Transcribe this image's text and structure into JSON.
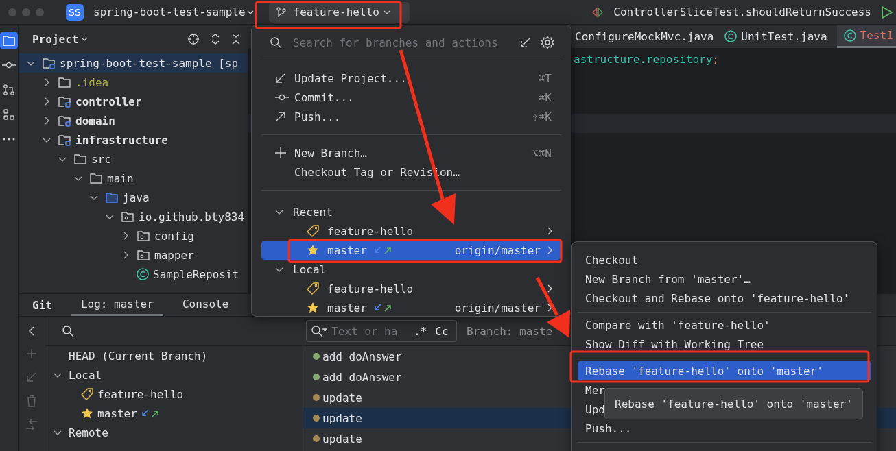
{
  "window": {
    "project_badge": "SS",
    "project": "spring-boot-test-sample",
    "branch": "feature-hello",
    "run_config": "ControllerSliceTest.shouldReturnSuccess"
  },
  "tool_strip": [
    {
      "selected": true
    },
    {
      "selected": false
    },
    {
      "selected": false
    },
    {
      "selected": false
    },
    {
      "selected": false
    }
  ],
  "project_panel": {
    "title": "Project",
    "tree": [
      {
        "label": "spring-boot-test-sample [sp",
        "kind": "module",
        "expanded": true,
        "selected": true,
        "ignored": false,
        "children": [
          {
            "label": ".idea",
            "kind": "folder",
            "expanded": false,
            "selected": false,
            "ignored": true
          },
          {
            "label": "controller",
            "kind": "module",
            "expanded": false,
            "selected": false,
            "ignored": false
          },
          {
            "label": "domain",
            "kind": "module",
            "expanded": false,
            "selected": false,
            "ignored": false
          },
          {
            "label": "infrastructure",
            "kind": "module",
            "expanded": true,
            "selected": false,
            "ignored": false,
            "children": [
              {
                "label": "src",
                "kind": "folder",
                "expanded": true,
                "selected": false,
                "ignored": false,
                "children": [
                  {
                    "label": "main",
                    "kind": "folder",
                    "expanded": true,
                    "selected": false,
                    "ignored": false,
                    "children": [
                      {
                        "label": "java",
                        "kind": "source",
                        "expanded": true,
                        "selected": false,
                        "ignored": false,
                        "children": [
                          {
                            "label": "io.github.bty834",
                            "kind": "package",
                            "expanded": true,
                            "selected": false,
                            "ignored": false,
                            "children": [
                              {
                                "label": "config",
                                "kind": "package",
                                "expanded": false,
                                "selected": false,
                                "ignored": false
                              },
                              {
                                "label": "mapper",
                                "kind": "package",
                                "expanded": false,
                                "selected": false,
                                "ignored": false
                              },
                              {
                                "label": "SampleReposit",
                                "kind": "class",
                                "selected": false,
                                "ignored": false
                              }
                            ]
                          }
                        ]
                      }
                    ]
                  }
                ]
              }
            ]
          }
        ]
      }
    ]
  },
  "editor": {
    "tabs": [
      {
        "label": "ConfigureMockMvc.java",
        "selected": false,
        "error": false,
        "icon": false
      },
      {
        "label": "UnitTest.java",
        "selected": false,
        "error": false,
        "icon": true
      },
      {
        "label": "Test1",
        "selected": true,
        "error": true,
        "icon": true
      }
    ],
    "code": [
      {
        "text": "astructure.repository",
        "kind": "identifier"
      },
      {
        "text": ";",
        "kind": "punct"
      }
    ]
  },
  "branch_popup": {
    "search": {
      "placeholder": "Search for branches and actions"
    },
    "action_groups": [
      [
        {
          "label": "Update Project...",
          "shortcut": "⌘T",
          "kind": "update"
        },
        {
          "label": "Commit...",
          "shortcut": "⌘K",
          "kind": "commit"
        },
        {
          "label": "Push...",
          "shortcut": "⇧⌘K",
          "kind": "push"
        }
      ],
      [
        {
          "label": "New Branch…",
          "shortcut": "⌥⌘N",
          "kind": "new"
        },
        {
          "label": "Checkout Tag or Revision…",
          "kind": "plain"
        }
      ]
    ],
    "branch_groups": [
      {
        "label": "Recent",
        "expanded": true,
        "branches": [
          {
            "name": "feature-hello",
            "kind": "tag",
            "selected": false,
            "sync": false
          },
          {
            "name": "master",
            "kind": "star",
            "selected": true,
            "sync": true,
            "remote": "origin/master"
          }
        ]
      },
      {
        "label": "Local",
        "expanded": true,
        "branches": [
          {
            "name": "feature-hello",
            "kind": "tag",
            "selected": false,
            "sync": false
          },
          {
            "name": "master",
            "kind": "star",
            "selected": false,
            "sync": true,
            "remote": "origin/master"
          }
        ]
      }
    ]
  },
  "branch_submenu": {
    "groups": [
      [
        {
          "label": "Checkout",
          "selected": false
        },
        {
          "label": "New Branch from 'master'…",
          "selected": false
        },
        {
          "label": "Checkout and Rebase onto 'feature-hello'",
          "selected": false
        }
      ],
      [
        {
          "label": "Compare with 'feature-hello'",
          "selected": false
        },
        {
          "label": "Show Diff with Working Tree",
          "selected": false
        }
      ],
      [
        {
          "label": "Rebase 'feature-hello' onto 'master'",
          "selected": true
        },
        {
          "label": "Mer",
          "selected": false
        },
        {
          "label": "Upd",
          "selected": false
        },
        {
          "label": "Push...",
          "selected": false
        }
      ]
    ],
    "tooltip": "Rebase 'feature-hello' onto 'master'"
  },
  "git_panel": {
    "title": "Git",
    "tabs": [
      {
        "label": "Log: master",
        "selected": true
      },
      {
        "label": "Console",
        "selected": false
      }
    ],
    "branches": [
      {
        "label": "HEAD (Current Branch)",
        "kind": "head"
      },
      {
        "label": "Local",
        "kind": "group",
        "expanded": true,
        "children": [
          {
            "label": "feature-hello",
            "kind": "tag",
            "sync": false
          },
          {
            "label": "master",
            "kind": "star",
            "sync": true
          }
        ]
      },
      {
        "label": "Remote",
        "kind": "group",
        "expanded": true
      }
    ],
    "log": {
      "filter": {
        "placeholder": "Text or ha"
      },
      "regex": ".*",
      "case": "Cc",
      "branch_filter": "Branch: maste",
      "commits": [
        {
          "message": "add doAnswer",
          "color": "#8aab74",
          "selected": false
        },
        {
          "message": "add doAnswer",
          "color": "#8aab74",
          "selected": false
        },
        {
          "message": "update",
          "color": "#a88a55",
          "selected": false
        },
        {
          "message": "update",
          "color": "#a88a55",
          "selected": true
        },
        {
          "message": "update",
          "color": "#a88a55",
          "selected": false
        }
      ]
    }
  }
}
